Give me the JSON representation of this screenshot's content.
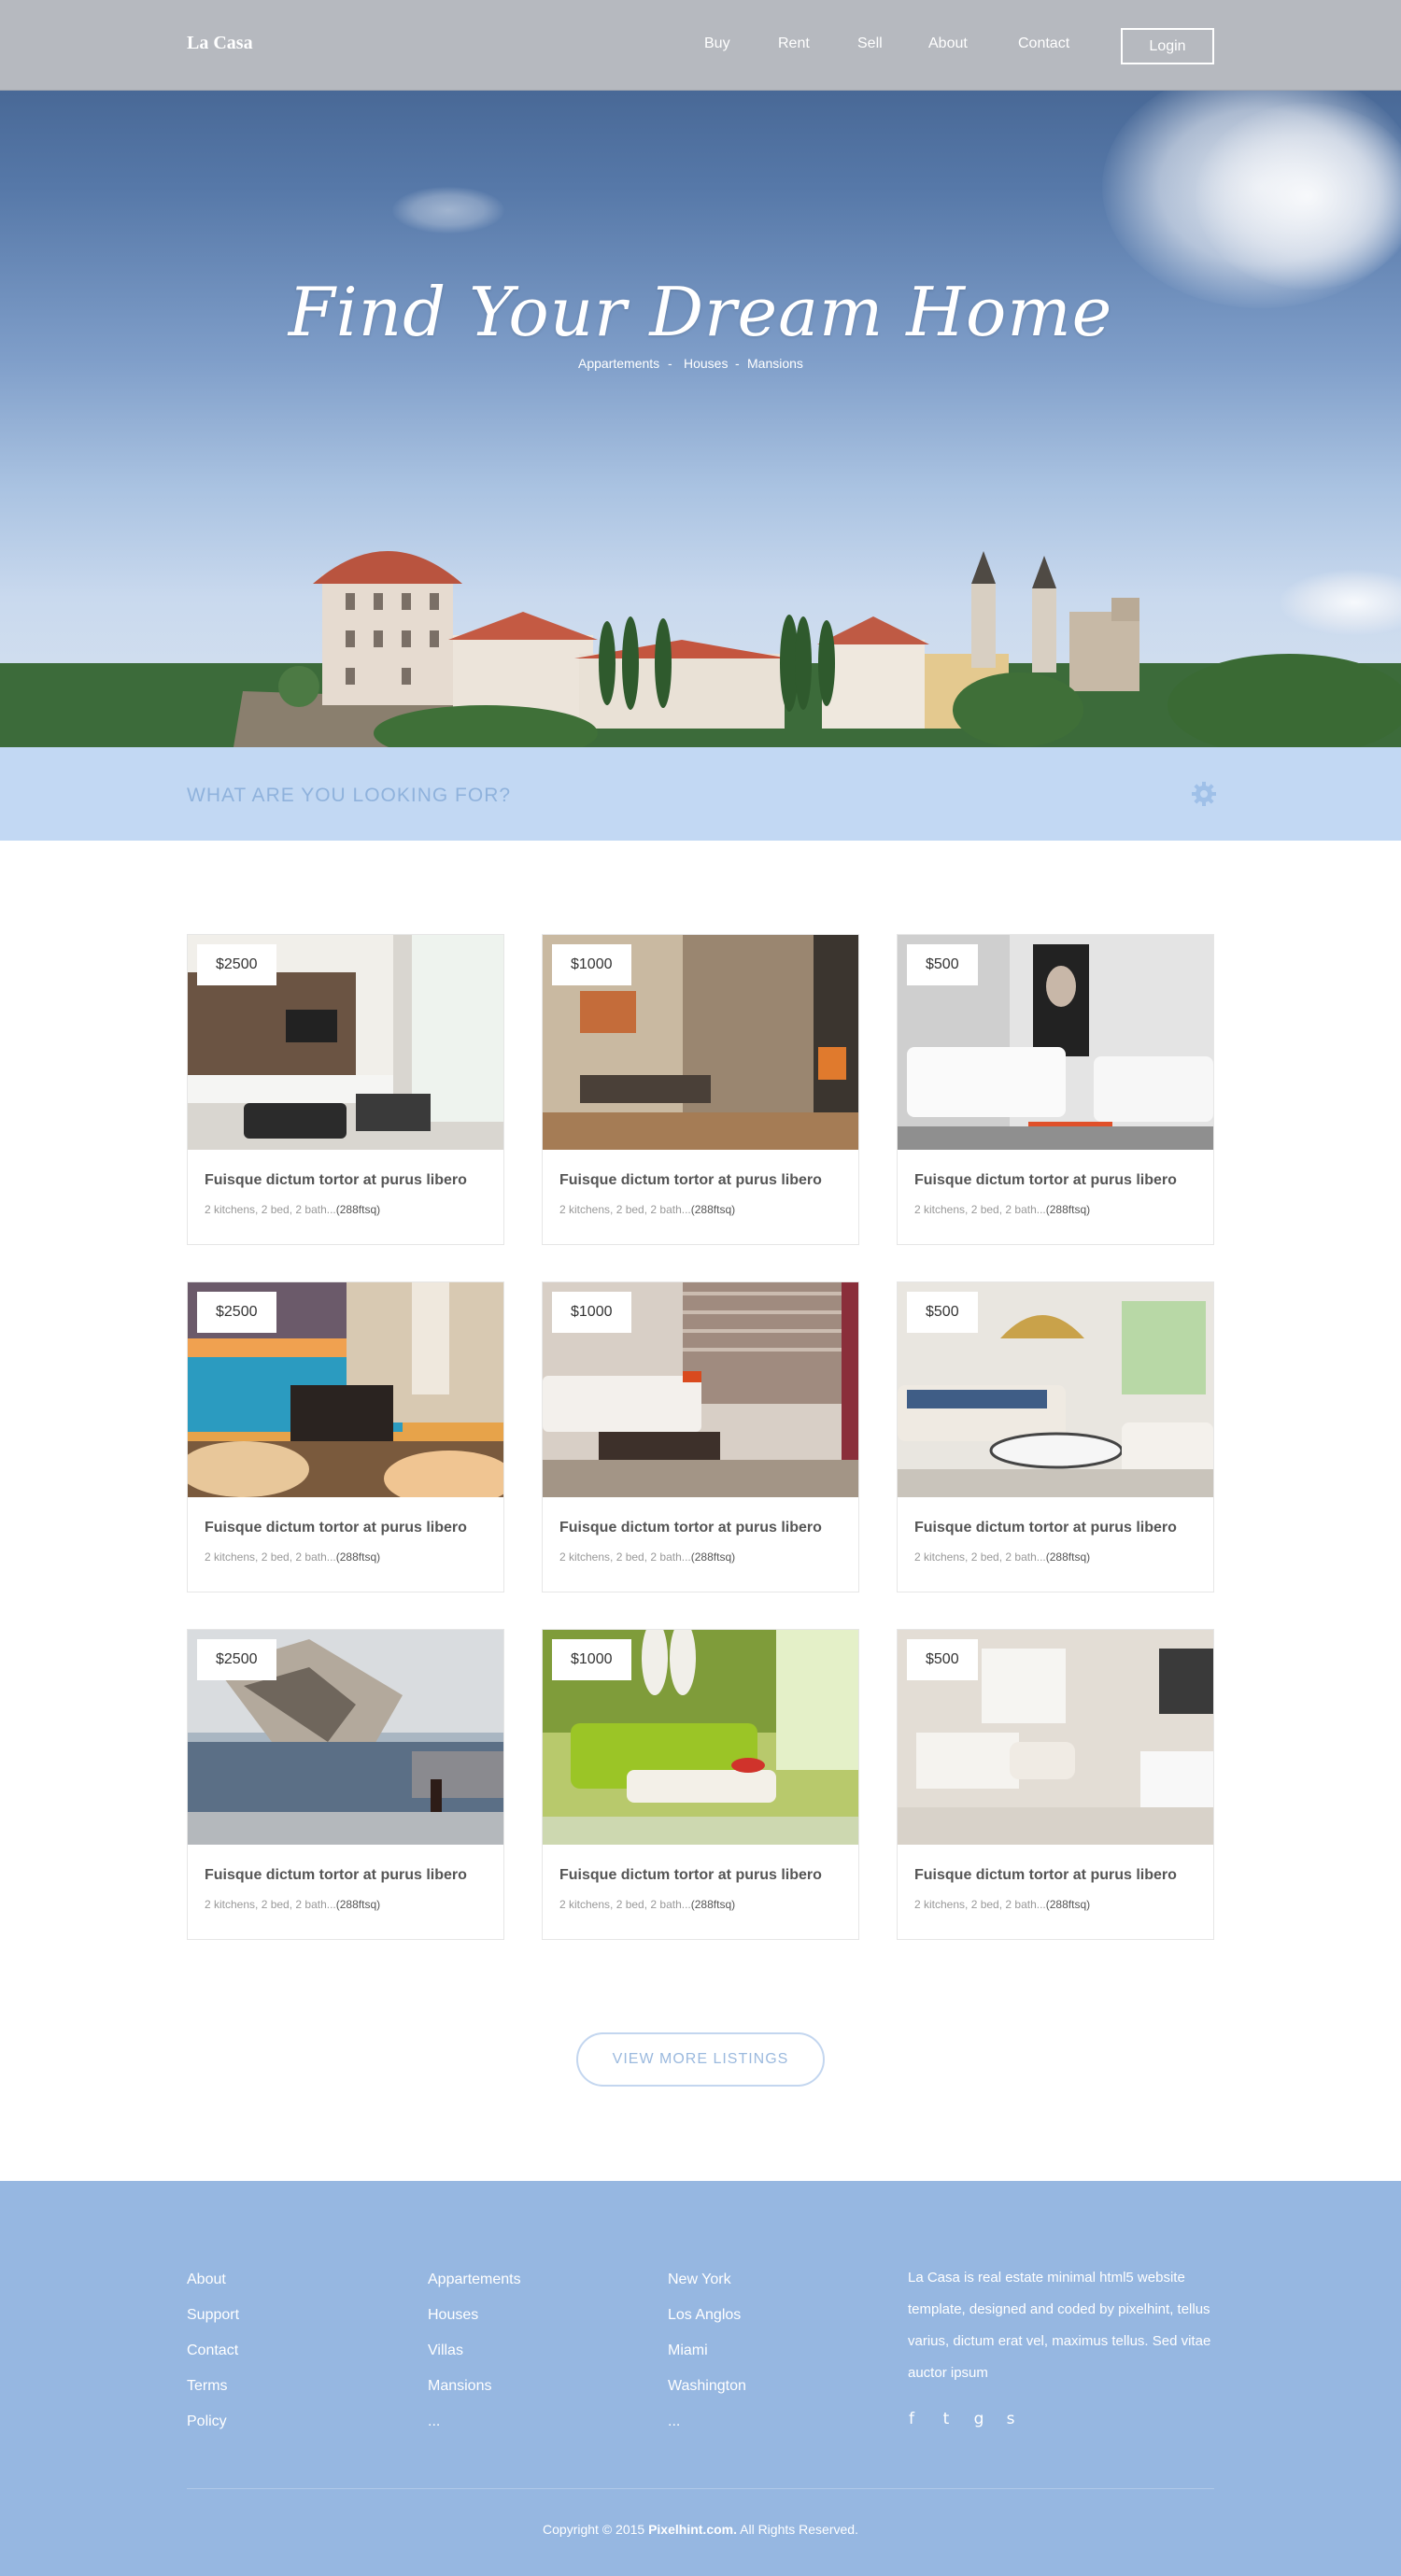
{
  "header": {
    "logo": "La Casa",
    "nav": [
      "Buy",
      "Rent",
      "Sell",
      "About",
      "Contact"
    ],
    "login": "Login"
  },
  "hero": {
    "title": "Find Your Dream Home",
    "subtitle": [
      "Appartements",
      "Houses",
      "Mansions"
    ],
    "separator": "-"
  },
  "search": {
    "prompt": "WHAT ARE YOU LOOKING FOR?",
    "icon": "gear-icon",
    "color": "#c2d8f3"
  },
  "listings": [
    {
      "price": "$2500",
      "title": "Fuisque dictum tortor at purus libero",
      "details": "2 kitchens, 2 bed, 2 bath...",
      "area": "(288ftsq)"
    },
    {
      "price": "$1000",
      "title": "Fuisque dictum tortor at purus libero",
      "details": "2 kitchens, 2 bed, 2 bath...",
      "area": "(288ftsq)"
    },
    {
      "price": "$500",
      "title": "Fuisque dictum tortor at purus libero",
      "details": "2 kitchens, 2 bed, 2 bath...",
      "area": "(288ftsq)"
    },
    {
      "price": "$2500",
      "title": "Fuisque dictum tortor at purus libero",
      "details": "2 kitchens, 2 bed, 2 bath...",
      "area": "(288ftsq)"
    },
    {
      "price": "$1000",
      "title": "Fuisque dictum tortor at purus libero",
      "details": "2 kitchens, 2 bed, 2 bath...",
      "area": "(288ftsq)"
    },
    {
      "price": "$500",
      "title": "Fuisque dictum tortor at purus libero",
      "details": "2 kitchens, 2 bed, 2 bath...",
      "area": "(288ftsq)"
    },
    {
      "price": "$2500",
      "title": "Fuisque dictum tortor at purus libero",
      "details": "2 kitchens, 2 bed, 2 bath...",
      "area": "(288ftsq)"
    },
    {
      "price": "$1000",
      "title": "Fuisque dictum tortor at purus libero",
      "details": "2 kitchens, 2 bed, 2 bath...",
      "area": "(288ftsq)"
    },
    {
      "price": "$500",
      "title": "Fuisque dictum tortor at purus libero",
      "details": "2 kitchens, 2 bed, 2 bath...",
      "area": "(288ftsq)"
    }
  ],
  "more_button": "VIEW MORE LISTINGS",
  "footer": {
    "col1": [
      "About",
      "Support",
      "Contact",
      "Terms",
      "Policy"
    ],
    "col2": [
      "Appartements",
      "Houses",
      "Villas",
      "Mansions",
      "..."
    ],
    "col3": [
      "New York",
      "Los Anglos",
      "Miami",
      "Washington",
      "..."
    ],
    "about": "La Casa is real estate minimal html5 website template, designed and coded by pixelhint, tellus varius, dictum erat vel, maximus tellus. Sed vitae auctor ipsum",
    "social_icons": [
      "facebook-icon",
      "twitter-icon",
      "google-plus-icon",
      "skype-icon"
    ],
    "social_glyphs": [
      "f",
      "t",
      "g",
      "s"
    ],
    "copyright_pre": "Copyright © 2015",
    "copyright_brand": "Pixelhint.com.",
    "copyright_post": "All Rights Reserved.",
    "color": "#96b7e1"
  }
}
